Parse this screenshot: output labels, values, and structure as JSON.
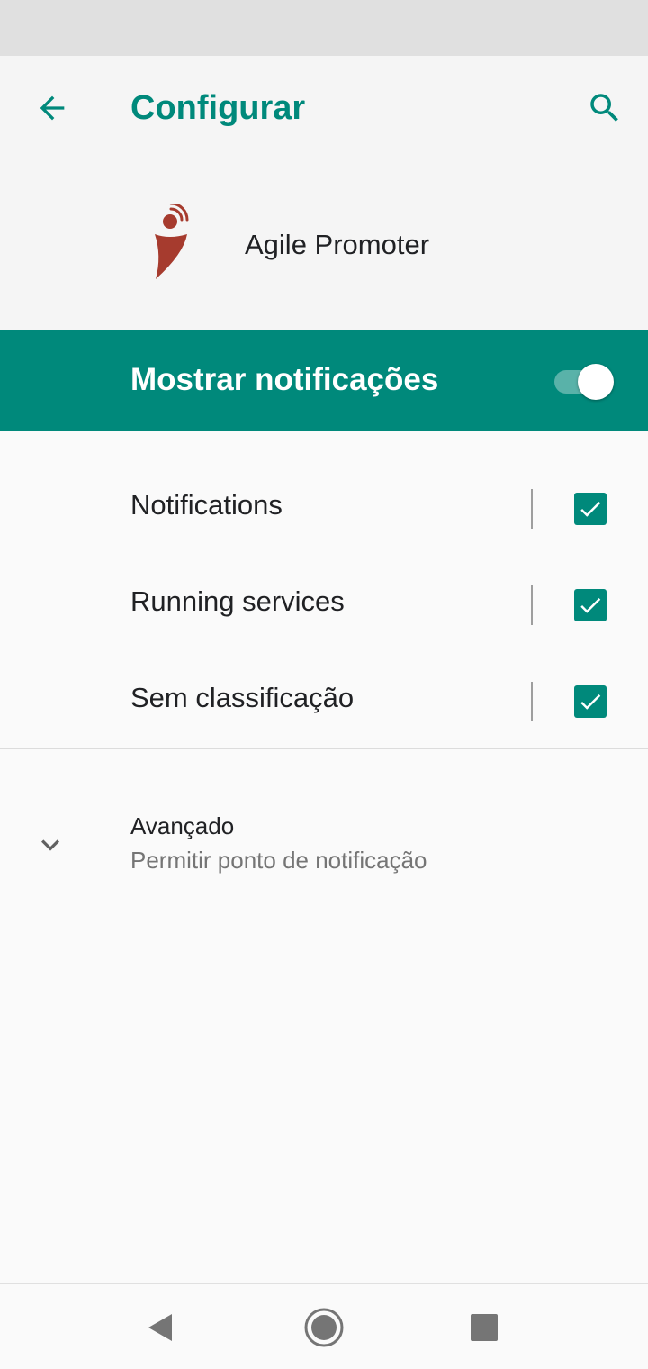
{
  "toolbar": {
    "title": "Configurar",
    "back_icon": "arrow-left-icon",
    "search_icon": "search-icon"
  },
  "app": {
    "name": "Agile Promoter",
    "logo_icon": "agile-promoter-logo"
  },
  "master_toggle": {
    "label": "Mostrar notificações",
    "on": true
  },
  "channels": [
    {
      "label": "Notifications",
      "checked": true
    },
    {
      "label": "Running services",
      "checked": true
    },
    {
      "label": "Sem classificação",
      "checked": true
    }
  ],
  "advanced": {
    "title": "Avançado",
    "summary": "Permitir ponto de notificação",
    "icon": "chevron-down-icon"
  },
  "colors": {
    "accent": "#00897b",
    "logo": "#a63b2e",
    "app_bar_bg": "#f5f5f5",
    "page_bg": "#fafafa",
    "status_bar_bg": "#e0e0e0"
  },
  "navigation": {
    "back_icon": "nav-back-icon",
    "home_icon": "nav-home-icon",
    "recents_icon": "nav-recents-icon"
  }
}
